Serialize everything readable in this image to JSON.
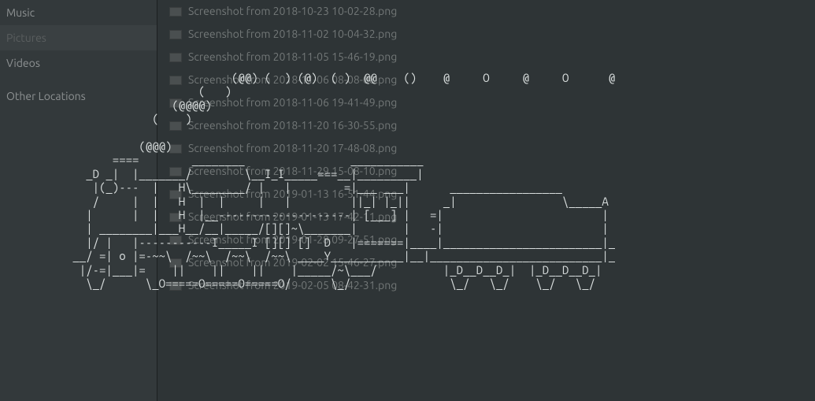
{
  "sidebar": {
    "items": [
      {
        "label": "Music",
        "active": false
      },
      {
        "label": "Pictures",
        "active": true
      },
      {
        "label": "Videos",
        "active": false
      },
      {
        "label": "Other Locations",
        "active": false
      }
    ]
  },
  "files": [
    {
      "name": "Screenshot from 2018-10-23 10-02-28.png"
    },
    {
      "name": "Screenshot from 2018-11-02 10-04-32.png"
    },
    {
      "name": "Screenshot from 2018-11-05 15-46-19.png"
    },
    {
      "name": "Screenshot from 2018-11-06 08-08-08.png"
    },
    {
      "name": "Screenshot from 2018-11-06 19-41-49.png"
    },
    {
      "name": "Screenshot from 2018-11-20 16-30-55.png"
    },
    {
      "name": "Screenshot from 2018-11-20 17-48-08.png"
    },
    {
      "name": "Screenshot from 2018-11-29 15-08-10.png"
    },
    {
      "name": "Screenshot from 2019-01-13 16-51-44.png"
    },
    {
      "name": "Screenshot from 2019-01-13 17-42-11.png"
    },
    {
      "name": "Screenshot from 2019-01-28 09-27-51.png"
    },
    {
      "name": "Screenshot from 2019-02-02 15-46-27.png"
    },
    {
      "name": "Screenshot from 2019-02-05 08-42-31.png"
    }
  ],
  "ascii_art": "                                   (@@) (  ) (@)  ( )  @@    ()    @     O     @     O      @\n                              (   )\n                          (@@@@)\n                       (    )\n\n                     (@@@)\n                 ====        ________                ___________\n             _D _|  |_______/        \\__I_I_____===__|_________|\n              |(_)---  |   H\\________/ |   |        =|___ ___|      _________________\n              /     |  |   H  |  |     |   |         ||_| |_||     _|                \\_____A\n             |      |  |   H  |__--------------------| [___] |   =|                        |\n             | ________|___H__/__|_____/[][]~\\_______|       |   -|                        |\n             |/ |   |-----------I_____I [][] []  D   |=======|____|________________________|_\n           __/ =| o |=-~~\\  /~~\\  /~~\\  /~~\\ ____Y___________|__|__________________________|_\n            |/-=|___|=    ||    ||    ||    |_____/~\\___/          |_D__D__D_|  |_D__D__D_|\n             \\_/      \\_O=====O=====O=====O/      \\_/               \\_/   \\_/    \\_/   \\_/"
}
